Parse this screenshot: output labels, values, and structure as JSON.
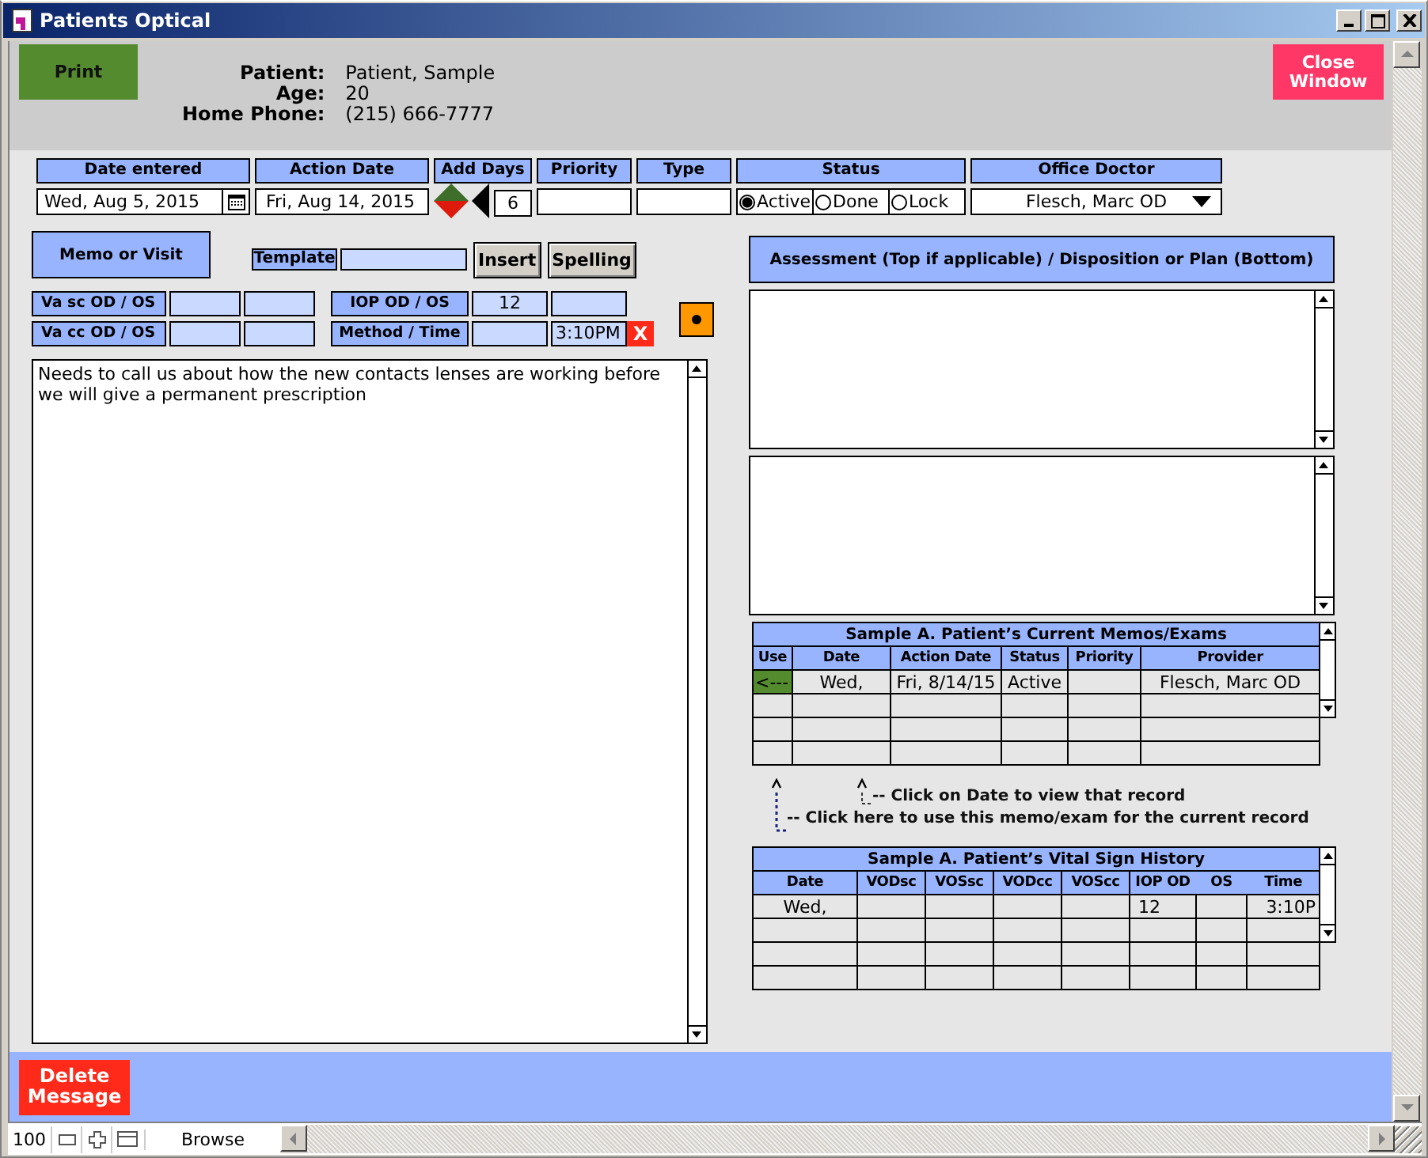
{
  "window": {
    "title": "Patients Optical"
  },
  "header": {
    "print_button": "Print",
    "close_button": "Close Window",
    "fields": [
      {
        "label": "Patient:",
        "value": "Patient, Sample"
      },
      {
        "label": "Age:",
        "value": "20"
      },
      {
        "label": "Home Phone:",
        "value": "(215) 666-7777"
      }
    ]
  },
  "record": {
    "date_entered": {
      "label": "Date entered",
      "value": "Wed, Aug 5, 2015"
    },
    "action_date": {
      "label": "Action Date",
      "value": "Fri, Aug 14, 2015"
    },
    "add_days": {
      "label": "Add Days",
      "value": "6"
    },
    "priority": {
      "label": "Priority"
    },
    "type": {
      "label": "Type"
    },
    "status": {
      "label": "Status",
      "options": [
        {
          "label": "Active",
          "selected": true
        },
        {
          "label": "Done",
          "selected": false
        },
        {
          "label": "Lock",
          "selected": false
        }
      ]
    },
    "office_doctor": {
      "label": "Office Doctor",
      "value": "Flesch, Marc OD"
    }
  },
  "memo": {
    "type_button": "Memo or Visit",
    "template_label": "Template",
    "insert_button": "Insert",
    "spelling_button": "Spelling",
    "text": "Needs to call us about how the new contacts lenses are working before we will give a permanent prescription"
  },
  "vitals": {
    "va_sc": {
      "label": "Va sc OD / OS"
    },
    "va_cc": {
      "label": "Va cc OD / OS"
    },
    "iop": {
      "label": "IOP OD / OS",
      "od": "12"
    },
    "method_time": {
      "label": "Method / Time",
      "time": "3:10PM",
      "clear_button": "X"
    }
  },
  "assessment": {
    "title": "Assessment (Top if applicable) / Disposition or Plan (Bottom)"
  },
  "memos_table": {
    "title": "Sample A. Patient’s Current Memos/Exams",
    "columns": [
      "Use",
      "Date",
      "Action Date",
      "Status",
      "Priority",
      "Provider"
    ],
    "rows": [
      {
        "use": "<---",
        "date": "Wed,",
        "action_date": "Fri, 8/14/15",
        "status": "Active",
        "provider": "Flesch, Marc OD"
      }
    ]
  },
  "hints": [
    "-- Click on Date to view that record",
    "-- Click here to use this memo/exam for the current record"
  ],
  "vitals_table": {
    "title": "Sample A. Patient’s Vital Sign History",
    "columns": [
      "Date",
      "VODsc",
      "VOSsc",
      "VODcc",
      "VOScc",
      "IOP OD",
      "OS",
      "Time"
    ],
    "rows": [
      {
        "date": "Wed,",
        "iop_od": "12",
        "time": "3:10P"
      }
    ]
  },
  "footer": {
    "delete_button": "Delete Message"
  },
  "status_bar": {
    "zoom": "100",
    "mode": "Browse"
  }
}
